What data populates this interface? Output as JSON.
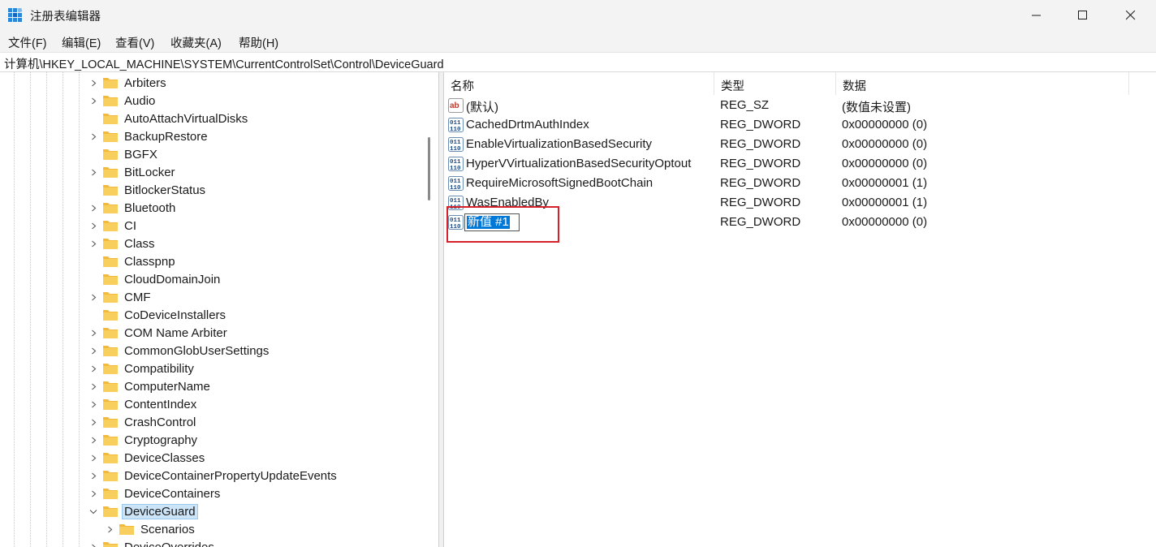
{
  "window": {
    "title": "注册表编辑器"
  },
  "menu": [
    {
      "label": "文件(F)",
      "name": "menu-file"
    },
    {
      "label": "编辑(E)",
      "name": "menu-edit"
    },
    {
      "label": "查看(V)",
      "name": "menu-view"
    },
    {
      "label": "收藏夹(A)",
      "name": "menu-favorites"
    },
    {
      "label": "帮助(H)",
      "name": "menu-help"
    }
  ],
  "address": {
    "path": "计算机\\HKEY_LOCAL_MACHINE\\SYSTEM\\CurrentControlSet\\Control\\DeviceGuard"
  },
  "tree": {
    "items": [
      {
        "label": "Arbiters",
        "expander": "collapsed",
        "level": 0
      },
      {
        "label": "Audio",
        "expander": "collapsed",
        "level": 0
      },
      {
        "label": "AutoAttachVirtualDisks",
        "expander": "none",
        "level": 0
      },
      {
        "label": "BackupRestore",
        "expander": "collapsed",
        "level": 0
      },
      {
        "label": "BGFX",
        "expander": "none",
        "level": 0
      },
      {
        "label": "BitLocker",
        "expander": "collapsed",
        "level": 0
      },
      {
        "label": "BitlockerStatus",
        "expander": "none",
        "level": 0
      },
      {
        "label": "Bluetooth",
        "expander": "collapsed",
        "level": 0
      },
      {
        "label": "CI",
        "expander": "collapsed",
        "level": 0
      },
      {
        "label": "Class",
        "expander": "collapsed",
        "level": 0
      },
      {
        "label": "Classpnp",
        "expander": "none",
        "level": 0
      },
      {
        "label": "CloudDomainJoin",
        "expander": "none",
        "level": 0
      },
      {
        "label": "CMF",
        "expander": "collapsed",
        "level": 0
      },
      {
        "label": "CoDeviceInstallers",
        "expander": "none",
        "level": 0
      },
      {
        "label": "COM Name Arbiter",
        "expander": "collapsed",
        "level": 0
      },
      {
        "label": "CommonGlobUserSettings",
        "expander": "collapsed",
        "level": 0
      },
      {
        "label": "Compatibility",
        "expander": "collapsed",
        "level": 0
      },
      {
        "label": "ComputerName",
        "expander": "collapsed",
        "level": 0
      },
      {
        "label": "ContentIndex",
        "expander": "collapsed",
        "level": 0
      },
      {
        "label": "CrashControl",
        "expander": "collapsed",
        "level": 0
      },
      {
        "label": "Cryptography",
        "expander": "collapsed",
        "level": 0
      },
      {
        "label": "DeviceClasses",
        "expander": "collapsed",
        "level": 0
      },
      {
        "label": "DeviceContainerPropertyUpdateEvents",
        "expander": "collapsed",
        "level": 0
      },
      {
        "label": "DeviceContainers",
        "expander": "collapsed",
        "level": 0
      },
      {
        "label": "DeviceGuard",
        "expander": "expanded",
        "level": 0,
        "selected": true
      },
      {
        "label": "Scenarios",
        "expander": "collapsed",
        "level": 1
      },
      {
        "label": "DeviceOverrides",
        "expander": "collapsed",
        "level": 0
      }
    ]
  },
  "list": {
    "columns": {
      "name": "名称",
      "type": "类型",
      "data": "数据"
    },
    "rows": [
      {
        "icon": "string-value-icon",
        "name": "(默认)",
        "type": "REG_SZ",
        "data": "(数值未设置)"
      },
      {
        "icon": "binary-value-icon",
        "name": "CachedDrtmAuthIndex",
        "type": "REG_DWORD",
        "data": "0x00000000 (0)"
      },
      {
        "icon": "binary-value-icon",
        "name": "EnableVirtualizationBasedSecurity",
        "type": "REG_DWORD",
        "data": "0x00000000 (0)"
      },
      {
        "icon": "binary-value-icon",
        "name": "HyperVVirtualizationBasedSecurityOptout",
        "type": "REG_DWORD",
        "data": "0x00000000 (0)"
      },
      {
        "icon": "binary-value-icon",
        "name": "RequireMicrosoftSignedBootChain",
        "type": "REG_DWORD",
        "data": "0x00000001 (1)"
      },
      {
        "icon": "binary-value-icon",
        "name": "WasEnabledBy",
        "type": "REG_DWORD",
        "data": "0x00000001 (1)"
      },
      {
        "icon": "binary-value-icon",
        "name": "新值 #1",
        "type": "REG_DWORD",
        "data": "0x00000000 (0)",
        "editing": true
      }
    ]
  },
  "colors": {
    "highlight_box": "#d6202a",
    "selection": "#0078d7",
    "folder": "#f8cf5d"
  }
}
